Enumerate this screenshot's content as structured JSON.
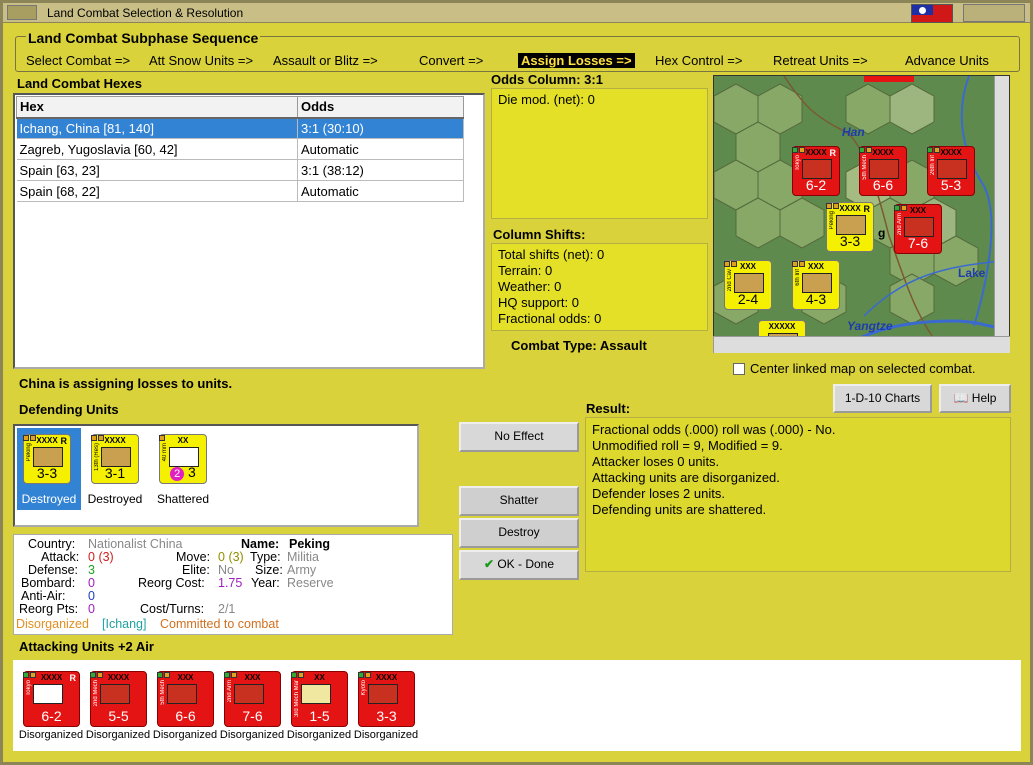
{
  "window": {
    "title": "Land Combat Selection & Resolution"
  },
  "phases": {
    "header": "Land Combat Subphase Sequence",
    "items": [
      "Select Combat =>",
      "Att Snow Units =>",
      "Assault or Blitz =>",
      "Convert =>",
      "Assign Losses =>",
      "Hex Control =>",
      "Retreat Units =>",
      "Advance Units"
    ],
    "selected": "Assign Losses =>"
  },
  "hexes": {
    "header": "Land Combat Hexes",
    "columns": [
      "Hex",
      "Odds"
    ],
    "rows": [
      [
        "Ichang, China [81, 140]",
        "3:1 (30:10)"
      ],
      [
        "Zagreb, Yugoslavia [60, 42]",
        "Automatic"
      ],
      [
        "Spain [63, 23]",
        "3:1 (38:12)"
      ],
      [
        "Spain [68, 22]",
        "Automatic"
      ]
    ]
  },
  "odds": {
    "header": "Odds Column: 3:1",
    "die_mod": "Die mod. (net): 0"
  },
  "shifts": {
    "header": "Column Shifts:",
    "lines": [
      "Total shifts (net): 0",
      "Terrain: 0",
      "Weather: 0",
      "HQ support: 0",
      "Fractional odds: 0"
    ]
  },
  "combat_type": "Combat Type:  Assault",
  "map": {
    "labels": [
      "Han",
      "Lake",
      "Yangtze",
      "g"
    ],
    "center_checkbox": "Center linked map on selected combat.",
    "counters": [
      {
        "size": "XXXX",
        "name": "Tokyo",
        "value": "6-2",
        "color": "red",
        "r": "R",
        "badge": "2"
      },
      {
        "size": "XXXX",
        "name": "5th Mech",
        "value": "6-6",
        "color": "red"
      },
      {
        "size": "XXXX",
        "name": "26th Inf",
        "value": "5-3",
        "color": "red"
      },
      {
        "size": "XXXX",
        "name": "Peking",
        "value": "3-3",
        "color": "yellow",
        "r": "R",
        "badge": "3"
      },
      {
        "size": "XXX",
        "name": "2nd Arm",
        "value": "7-6",
        "color": "red"
      },
      {
        "size": "XXX",
        "name": "2nd Cav",
        "value": "2-4",
        "color": "yellow",
        "badge": "2"
      },
      {
        "size": "XXX",
        "name": "6th Inf",
        "value": "4-3",
        "color": "yellow"
      },
      {
        "size": "XXXXX",
        "name": "",
        "value": "",
        "color": "yellow"
      }
    ]
  },
  "buttons": {
    "charts": "1-D-10 Charts",
    "help": "Help",
    "no_effect": "No Effect",
    "shatter": "Shatter",
    "destroy": "Destroy",
    "ok": "OK - Done"
  },
  "status": "China is assigning losses to units.",
  "defenders": {
    "header": "Defending Units",
    "units": [
      {
        "size": "XXXX",
        "name": "Peking",
        "value": "3-3",
        "r": "R",
        "status": "Destroyed",
        "selected": true
      },
      {
        "size": "XXXX",
        "name": "13th (Res)",
        "value": "3-1",
        "status": "Destroyed"
      },
      {
        "size": "XX",
        "name": "40 mm",
        "value": "3",
        "badge": "2",
        "status": "Shattered"
      }
    ]
  },
  "result": {
    "header": "Result:",
    "lines": [
      "Fractional odds (.000) roll was (.000)  - No.",
      "Unmodified roll = 9, Modified = 9.",
      "Attacker loses 0 units.",
      "Attacking units are disorganized.",
      "Defender loses 2 units.",
      "Defending units are shattered."
    ]
  },
  "details": {
    "country_label": "Country:",
    "country": "Nationalist China",
    "name_label": "Name:",
    "name": "Peking",
    "attack_label": "Attack:",
    "attack": "0",
    "attack_paren": "(3)",
    "move_label": "Move:",
    "move": "0",
    "move_paren": "(3)",
    "type_label": "Type:",
    "type": "Militia",
    "defense_label": "Defense:",
    "defense": "3",
    "elite_label": "Elite:",
    "elite": "No",
    "size_label": "Size:",
    "size": "Army",
    "bombard_label": "Bombard:",
    "bombard": "0",
    "reorg_cost_label": "Reorg Cost:",
    "reorg_cost": "1.75",
    "year_label": "Year:",
    "year": "Reserve",
    "antiair_label": "Anti-Air:",
    "antiair": "0",
    "reorg_pts_label": "Reorg Pts:",
    "reorg_pts": "0",
    "cost_turns_label": "Cost/Turns:",
    "cost_turns": "2/1",
    "disorg": "Disorganized",
    "location": "[Ichang]",
    "committed": "Committed to combat"
  },
  "attackers": {
    "header": "Attacking Units +2 Air",
    "units": [
      {
        "size": "XXXX",
        "name": "Tokyo",
        "value": "6-2",
        "r": "R",
        "status": "Disorganized"
      },
      {
        "size": "XXXX",
        "name": "2nd Mech",
        "value": "5-5",
        "status": "Disorganized"
      },
      {
        "size": "XXX",
        "name": "5th Mech",
        "value": "6-6",
        "status": "Disorganized"
      },
      {
        "size": "XXX",
        "name": "2nd Arm",
        "value": "7-6",
        "status": "Disorganized"
      },
      {
        "size": "XX",
        "name": "3rd Mech Mar",
        "value": "1-5",
        "status": "Disorganized"
      },
      {
        "size": "XXXX",
        "name": "Kyoto",
        "value": "3-3",
        "status": "Disorganized"
      }
    ]
  }
}
